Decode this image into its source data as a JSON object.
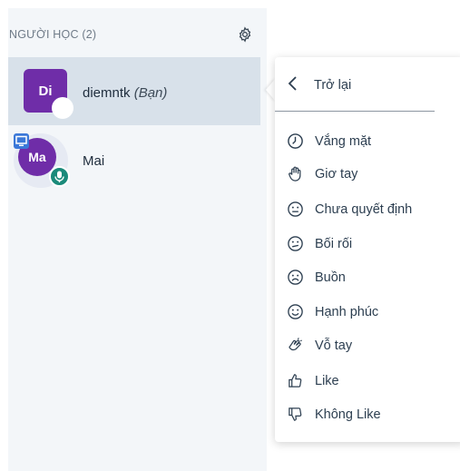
{
  "panel": {
    "title": "NGƯỜI HỌC (2)"
  },
  "users": {
    "me": {
      "initials": "Di",
      "name": "diemntk",
      "suffix": "(Bạn)",
      "color": "#6f2da8"
    },
    "other": {
      "initials": "Ma",
      "name": "Mai",
      "color": "#6f2da8"
    }
  },
  "menu": {
    "back_label": "Trở lại",
    "items": [
      {
        "label": "Vắng mặt",
        "icon": "clock-icon"
      },
      {
        "label": "Giơ tay",
        "icon": "raised-hand-icon"
      },
      {
        "label": "Chưa quyết định",
        "icon": "neutral-face-icon"
      },
      {
        "label": "Bối rối",
        "icon": "confused-face-icon"
      },
      {
        "label": "Buồn",
        "icon": "sad-face-icon"
      },
      {
        "label": "Hạnh phúc",
        "icon": "happy-face-icon"
      },
      {
        "label": "Vỗ tay",
        "icon": "applause-icon"
      },
      {
        "label": "Like",
        "icon": "thumbs-up-icon"
      },
      {
        "label": "Không Like",
        "icon": "thumbs-down-icon"
      }
    ]
  }
}
